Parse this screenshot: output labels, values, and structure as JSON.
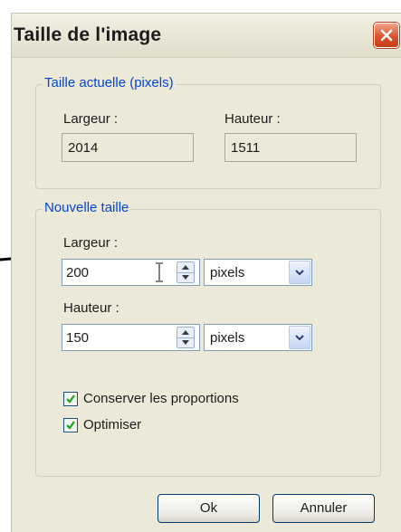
{
  "dialog": {
    "title": "Taille de l'image"
  },
  "current_size": {
    "legend": "Taille actuelle (pixels)",
    "width_label": "Largeur :",
    "width_value": "2014",
    "height_label": "Hauteur :",
    "height_value": "1511"
  },
  "new_size": {
    "legend": "Nouvelle taille",
    "width_label": "Largeur :",
    "width_value": "200",
    "width_unit": "pixels",
    "height_label": "Hauteur :",
    "height_value": "150",
    "height_unit": "pixels"
  },
  "options": {
    "keep_proportions_label": "Conserver les proportions",
    "keep_proportions_checked": true,
    "optimize_label": "Optimiser",
    "optimize_checked": true
  },
  "buttons": {
    "ok": "Ok",
    "cancel": "Annuler"
  },
  "icons": {
    "close": "close-icon",
    "spin_up": "spin-up-icon",
    "spin_down": "spin-down-icon",
    "dropdown": "chevron-down-icon",
    "check": "checkmark-icon",
    "cursor": "text-cursor-icon",
    "annotation": "arrow-right-icon"
  },
  "colors": {
    "dialog_bg": "#ece9d8",
    "legend_text": "#0046d5",
    "close_button": "#d7552e",
    "checkmark": "#21a121"
  }
}
